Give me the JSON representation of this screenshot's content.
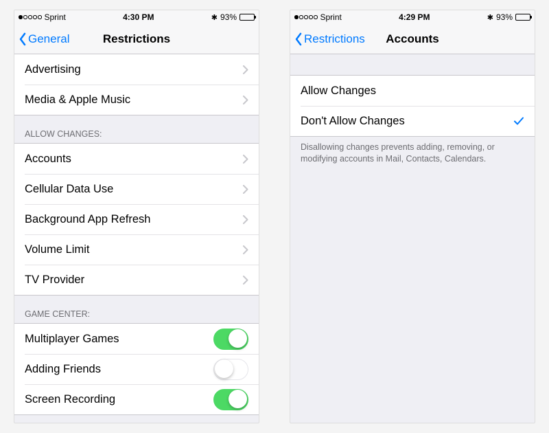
{
  "left": {
    "status": {
      "carrier": "Sprint",
      "time": "4:30 PM",
      "battery_pct": "93%"
    },
    "nav": {
      "back": "General",
      "title": "Restrictions"
    },
    "section_top": {
      "items": [
        {
          "label": "Advertising"
        },
        {
          "label": "Media & Apple Music"
        }
      ]
    },
    "section_allow": {
      "header": "Allow Changes:",
      "items": [
        {
          "label": "Accounts"
        },
        {
          "label": "Cellular Data Use"
        },
        {
          "label": "Background App Refresh"
        },
        {
          "label": "Volume Limit"
        },
        {
          "label": "TV Provider"
        }
      ]
    },
    "section_gc": {
      "header": "Game Center:",
      "items": [
        {
          "label": "Multiplayer Games",
          "on": true
        },
        {
          "label": "Adding Friends",
          "on": false
        },
        {
          "label": "Screen Recording",
          "on": true
        }
      ]
    }
  },
  "right": {
    "status": {
      "carrier": "Sprint",
      "time": "4:29 PM",
      "battery_pct": "93%"
    },
    "nav": {
      "back": "Restrictions",
      "title": "Accounts"
    },
    "options": {
      "items": [
        {
          "label": "Allow Changes",
          "selected": false
        },
        {
          "label": "Don't Allow Changes",
          "selected": true
        }
      ],
      "footer": "Disallowing changes prevents adding, removing, or modifying accounts in Mail, Contacts, Calendars."
    }
  }
}
